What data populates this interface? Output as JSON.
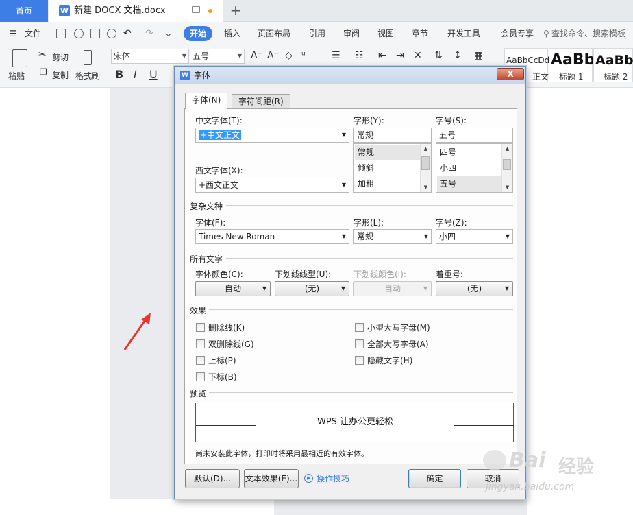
{
  "tabs": {
    "home": "首页",
    "document": "新建 DOCX 文档.docx"
  },
  "menu": {
    "file": "文件",
    "items": [
      "开始",
      "插入",
      "页面布局",
      "引用",
      "审阅",
      "视图",
      "章节",
      "开发工具",
      "会员专享"
    ],
    "search": "查找命令、搜索模板"
  },
  "ribbon": {
    "paste": "粘贴",
    "cut": "剪切",
    "copy": "复制",
    "format_painter": "格式刷",
    "font_name": "宋体",
    "font_size": "五号",
    "styles": [
      {
        "sample": "AaBbCcDd",
        "name": "正文"
      },
      {
        "sample": "AaBb",
        "name": "标题 1"
      },
      {
        "sample": "AaBb",
        "name": "标题 2"
      }
    ]
  },
  "dialog": {
    "title": "字体",
    "close": "X",
    "tabs": [
      "字体(N)",
      "字符间距(R)"
    ],
    "chinese_font_label": "中文字体(T):",
    "chinese_font_value": "+中文正文",
    "western_font_label": "西文字体(X):",
    "western_font_value": "+西文正文",
    "style_label": "字形(Y):",
    "style_value": "常规",
    "style_options": [
      "常规",
      "倾斜",
      "加粗"
    ],
    "size_label": "字号(S):",
    "size_value": "五号",
    "size_options": [
      "四号",
      "小四",
      "五号"
    ],
    "complex_group": "复杂文种",
    "complex_font_label": "字体(F):",
    "complex_font_value": "Times New Roman",
    "complex_style_label": "字形(L):",
    "complex_style_value": "常规",
    "complex_size_label": "字号(Z):",
    "complex_size_value": "小四",
    "all_text_group": "所有文字",
    "font_color_label": "字体颜色(C):",
    "font_color_value": "自动",
    "underline_type_label": "下划线线型(U):",
    "underline_type_value": "(无)",
    "underline_color_label": "下划线颜色(I):",
    "underline_color_value": "自动",
    "emphasis_label": "着重号:",
    "emphasis_value": "(无)",
    "effects_group": "效果",
    "effects_left": [
      "删除线(K)",
      "双删除线(G)",
      "上标(P)",
      "下标(B)"
    ],
    "effects_right": [
      "小型大写字母(M)",
      "全部大写字母(A)",
      "隐藏文字(H)"
    ],
    "preview_group": "预览",
    "preview_text": "WPS 让办公更轻松",
    "note": "尚未安装此字体，打印时将采用最相近的有效字体。",
    "default_button": "默认(D)...",
    "text_effect_button": "文本效果(E)...",
    "tips_link": "操作技巧",
    "ok_button": "确定",
    "cancel_button": "取消"
  },
  "watermark": {
    "brand": "Bai",
    "brand2": "经验",
    "url": "jingyan.baidu.com"
  },
  "colors": {
    "accent": "#3d7ee6",
    "close": "#c8452a",
    "arrow": "#e8342a"
  }
}
